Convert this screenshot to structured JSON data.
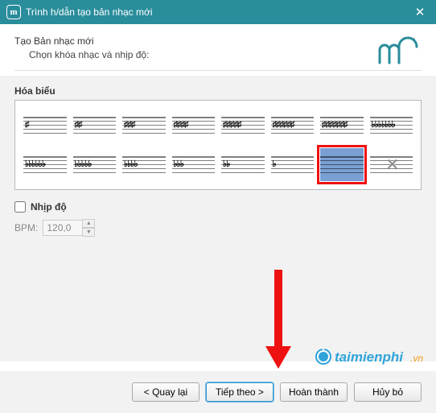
{
  "window": {
    "title": "Trình h/dẫn tạo bản nhạc mới",
    "icon_letter": "m̃"
  },
  "header": {
    "line1": "Tạo Bản nhạc mới",
    "line2": "Chọn khóa nhạc và nhịp độ:"
  },
  "keysig": {
    "group_label": "Hóa biểu",
    "cells": [
      {
        "name": "g-major",
        "display": "♯",
        "selected": false
      },
      {
        "name": "d-major",
        "display": "♯♯",
        "selected": false
      },
      {
        "name": "a-major",
        "display": "♯♯♯",
        "selected": false
      },
      {
        "name": "e-major",
        "display": "♯♯♯♯",
        "selected": false
      },
      {
        "name": "b-major",
        "display": "♯♯♯♯♯",
        "selected": false
      },
      {
        "name": "fsharp-major",
        "display": "♯♯♯♯♯♯",
        "selected": false
      },
      {
        "name": "csharp-major",
        "display": "♯♯♯♯♯♯♯",
        "selected": false
      },
      {
        "name": "cflat-major",
        "display": "♭♭♭♭♭♭♭",
        "selected": false
      },
      {
        "name": "gflat-major",
        "display": "♭♭♭♭♭♭",
        "selected": false
      },
      {
        "name": "dflat-major",
        "display": "♭♭♭♭♭",
        "selected": false
      },
      {
        "name": "aflat-major",
        "display": "♭♭♭♭",
        "selected": false
      },
      {
        "name": "eflat-major",
        "display": "♭♭♭",
        "selected": false
      },
      {
        "name": "bflat-major",
        "display": "♭♭",
        "selected": false
      },
      {
        "name": "f-major",
        "display": "♭",
        "selected": false
      },
      {
        "name": "c-major-no-sig",
        "display": "",
        "selected": true
      },
      {
        "name": "atonal",
        "display": "✕",
        "x": true,
        "selected": false
      }
    ]
  },
  "tempo": {
    "checkbox_label": "Nhịp độ",
    "checked": false,
    "bpm_label": "BPM:",
    "bpm_value": "120,0"
  },
  "footer": {
    "back_label": "< Quay lại",
    "next_label": "Tiếp theo >",
    "finish_label": "Hoàn thành",
    "cancel_label": "Hủy bỏ"
  },
  "watermark": {
    "text": "taimienphi",
    "suffix": ".vn"
  }
}
